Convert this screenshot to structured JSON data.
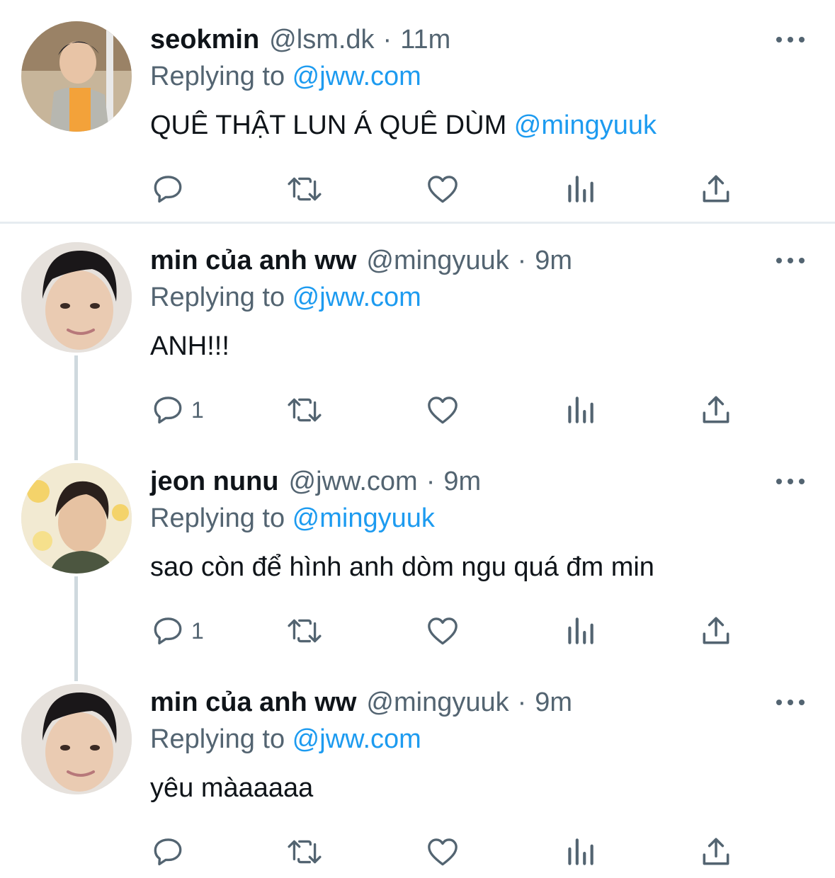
{
  "tweets": [
    {
      "name": "seokmin",
      "handle": "@lsm.dk",
      "separator": "·",
      "time": "11m",
      "replying_prefix": "Replying to ",
      "replying_to": "@jww.com",
      "text": "QUÊ THẬT LUN Á QUÊ DÙM ",
      "text_mention": "@mingyuuk",
      "reply_count": "",
      "avatar": "avatar-seokmin"
    },
    {
      "name": "min của anh ww",
      "handle": "@mingyuuk",
      "separator": "·",
      "time": "9m",
      "replying_prefix": "Replying to ",
      "replying_to": "@jww.com",
      "text": "ANH!!!",
      "text_mention": "",
      "reply_count": "1",
      "avatar": "avatar-min"
    },
    {
      "name": "jeon nunu",
      "handle": "@jww.com",
      "separator": "·",
      "time": "9m",
      "replying_prefix": "Replying to ",
      "replying_to": "@mingyuuk",
      "text": "sao còn để hình anh dòm ngu quá đm min",
      "text_mention": "",
      "reply_count": "1",
      "avatar": "avatar-jeon"
    },
    {
      "name": "min của anh ww",
      "handle": "@mingyuuk",
      "separator": "·",
      "time": "9m",
      "replying_prefix": "Replying to ",
      "replying_to": "@jww.com",
      "text": "yêu màaaaaa",
      "text_mention": "",
      "reply_count": "",
      "avatar": "avatar-min"
    }
  ],
  "icons": {
    "reply": "reply-icon",
    "retweet": "retweet-icon",
    "like": "heart-icon",
    "views": "analytics-icon",
    "share": "share-icon",
    "more": "more-icon"
  },
  "colors": {
    "link": "#1d9bf0",
    "secondary_text": "#536471",
    "primary_text": "#0f1419",
    "divider": "#e6ecf0",
    "thread_line": "#cfd9de"
  }
}
